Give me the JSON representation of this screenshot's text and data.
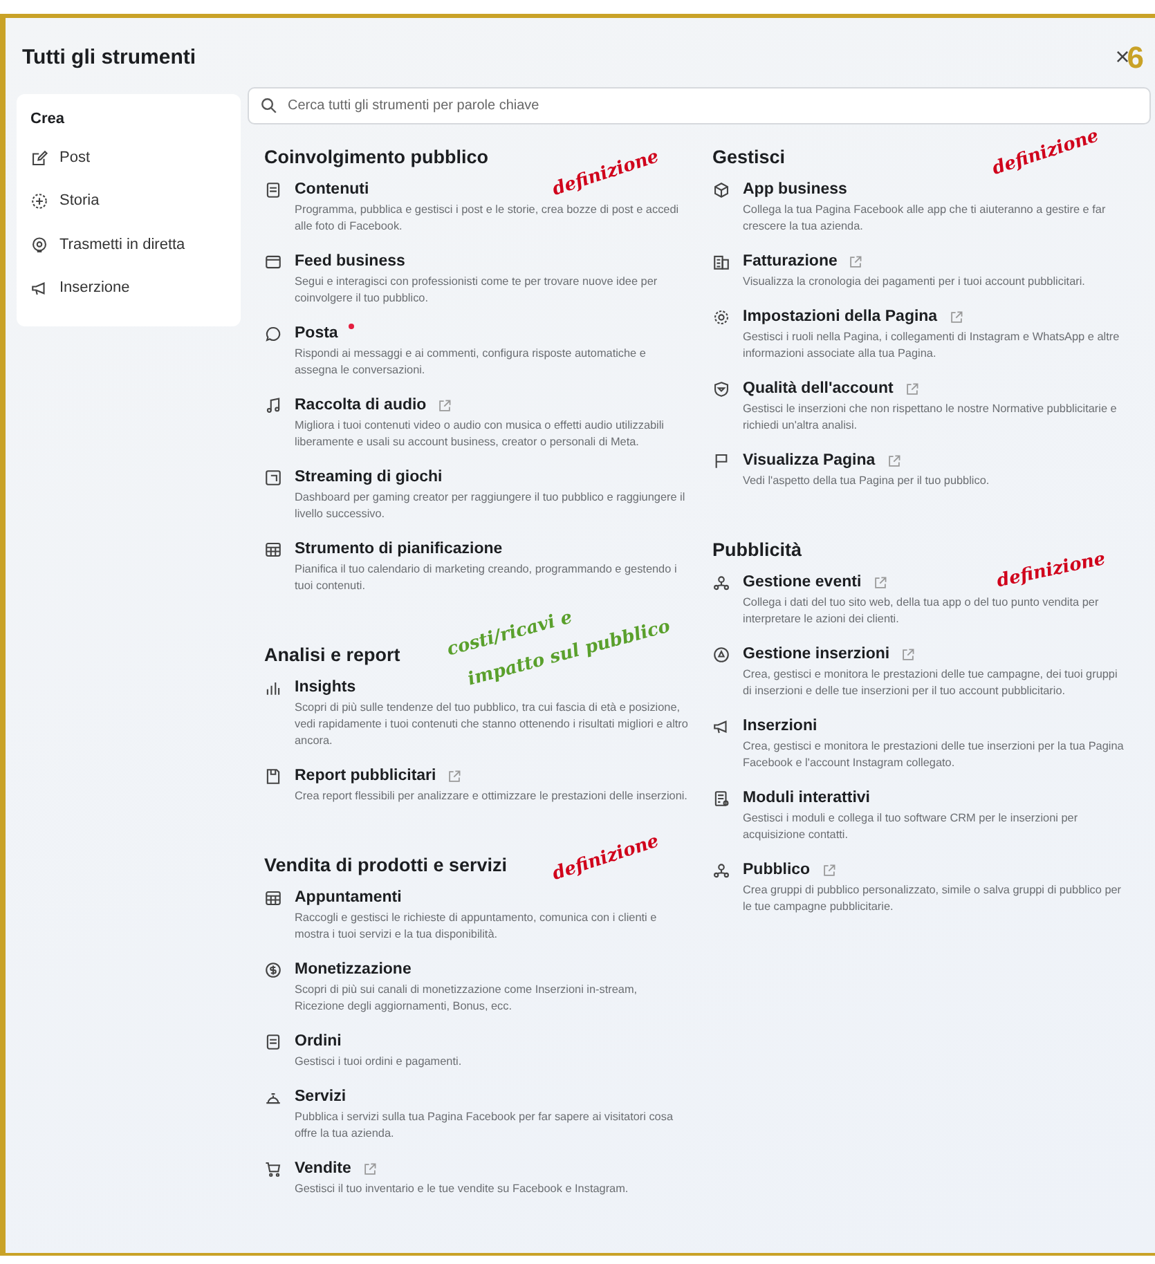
{
  "window": {
    "title": "Tutti gli strumenti",
    "close": "×"
  },
  "page_number": "6",
  "sidebar": {
    "heading": "Crea",
    "items": [
      {
        "label": "Post"
      },
      {
        "label": "Storia"
      },
      {
        "label": "Trasmetti in diretta"
      },
      {
        "label": "Inserzione"
      }
    ]
  },
  "search": {
    "placeholder": "Cerca tutti gli strumenti per parole chiave"
  },
  "columns": [
    {
      "sections": [
        {
          "heading": "Coinvolgimento pubblico",
          "items": [
            {
              "title": "Contenuti",
              "description": "Programma, pubblica e gestisci i post e le storie, crea bozze di post e accedi alle foto di Facebook.",
              "external": false,
              "unread": false
            },
            {
              "title": "Feed business",
              "description": "Segui e interagisci con professionisti come te per trovare nuove idee per coinvolgere il tuo pubblico.",
              "external": false,
              "unread": false
            },
            {
              "title": "Posta",
              "description": "Rispondi ai messaggi e ai commenti, configura risposte automatiche e assegna le conversazioni.",
              "external": false,
              "unread": true
            },
            {
              "title": "Raccolta di audio",
              "description": "Migliora i tuoi contenuti video o audio con musica o effetti audio utilizzabili liberamente e usali su account business, creator o personali di Meta.",
              "external": true,
              "unread": false
            },
            {
              "title": "Streaming di giochi",
              "description": "Dashboard per gaming creator per raggiungere il tuo pubblico e raggiungere il livello successivo.",
              "external": false,
              "unread": false
            },
            {
              "title": "Strumento di pianificazione",
              "description": "Pianifica il tuo calendario di marketing creando, programmando e gestendo i tuoi contenuti.",
              "external": false,
              "unread": false
            }
          ]
        },
        {
          "heading": "Analisi e report",
          "items": [
            {
              "title": "Insights",
              "description": "Scopri di più sulle tendenze del tuo pubblico, tra cui fascia di età e posizione, vedi rapidamente i tuoi contenuti che stanno ottenendo i risultati migliori e altro ancora.",
              "external": false,
              "unread": false
            },
            {
              "title": "Report pubblicitari",
              "description": "Crea report flessibili per analizzare e ottimizzare le prestazioni delle inserzioni.",
              "external": true,
              "unread": false
            }
          ]
        },
        {
          "heading": "Vendita di prodotti e servizi",
          "items": [
            {
              "title": "Appuntamenti",
              "description": "Raccogli e gestisci le richieste di appuntamento, comunica con i clienti e mostra i tuoi servizi e la tua disponibilità.",
              "external": false,
              "unread": false
            },
            {
              "title": "Monetizzazione",
              "description": "Scopri di più sui canali di monetizzazione come Inserzioni in-stream, Ricezione degli aggiornamenti, Bonus, ecc.",
              "external": false,
              "unread": false
            },
            {
              "title": "Ordini",
              "description": "Gestisci i tuoi ordini e pagamenti.",
              "external": false,
              "unread": false
            },
            {
              "title": "Servizi",
              "description": "Pubblica i servizi sulla tua Pagina Facebook per far sapere ai visitatori cosa offre la tua azienda.",
              "external": false,
              "unread": false
            },
            {
              "title": "Vendite",
              "description": "Gestisci il tuo inventario e le tue vendite su Facebook e Instagram.",
              "external": true,
              "unread": false
            }
          ]
        }
      ]
    },
    {
      "sections": [
        {
          "heading": "Gestisci",
          "items": [
            {
              "title": "App business",
              "description": "Collega la tua Pagina Facebook alle app che ti aiuteranno a gestire e far crescere la tua azienda.",
              "external": false,
              "unread": false
            },
            {
              "title": "Fatturazione",
              "description": "Visualizza la cronologia dei pagamenti per i tuoi account pubblicitari.",
              "external": true,
              "unread": false
            },
            {
              "title": "Impostazioni della Pagina",
              "description": "Gestisci i ruoli nella Pagina, i collegamenti di Instagram e WhatsApp e altre informazioni associate alla tua Pagina.",
              "external": true,
              "unread": false
            },
            {
              "title": "Qualità dell'account",
              "description": "Gestisci le inserzioni che non rispettano le nostre Normative pubblicitarie e richiedi un'altra analisi.",
              "external": true,
              "unread": false
            },
            {
              "title": "Visualizza Pagina",
              "description": "Vedi l'aspetto della tua Pagina per il tuo pubblico.",
              "external": true,
              "unread": false
            }
          ]
        },
        {
          "heading": "Pubblicità",
          "items": [
            {
              "title": "Gestione eventi",
              "description": "Collega i dati del tuo sito web, della tua app o del tuo punto vendita per interpretare le azioni dei clienti.",
              "external": true,
              "unread": false
            },
            {
              "title": "Gestione inserzioni",
              "description": "Crea, gestisci e monitora le prestazioni delle tue campagne, dei tuoi gruppi di inserzioni e delle tue inserzioni per il tuo account pubblicitario.",
              "external": true,
              "unread": false
            },
            {
              "title": "Inserzioni",
              "description": "Crea, gestisci e monitora le prestazioni delle tue inserzioni per la tua Pagina Facebook e l'account Instagram collegato.",
              "external": false,
              "unread": false
            },
            {
              "title": "Moduli interattivi",
              "description": "Gestisci i moduli e collega il tuo software CRM per le inserzioni per acquisizione contatti.",
              "external": false,
              "unread": false
            },
            {
              "title": "Pubblico",
              "description": "Crea gruppi di pubblico personalizzato, simile o salva gruppi di pubblico per le tue campagne pubblicitarie.",
              "external": true,
              "unread": false
            }
          ]
        }
      ]
    }
  ],
  "annotations": [
    {
      "text": "definizione",
      "color": "#d0021b"
    },
    {
      "text": "definizione",
      "color": "#d0021b"
    },
    {
      "text": "costi/ricavi e",
      "color": "#5aa02c"
    },
    {
      "text": "impatto sul pubblico",
      "color": "#5aa02c"
    },
    {
      "text": "definizione",
      "color": "#d0021b"
    },
    {
      "text": "definizione",
      "color": "#d0021b"
    }
  ]
}
